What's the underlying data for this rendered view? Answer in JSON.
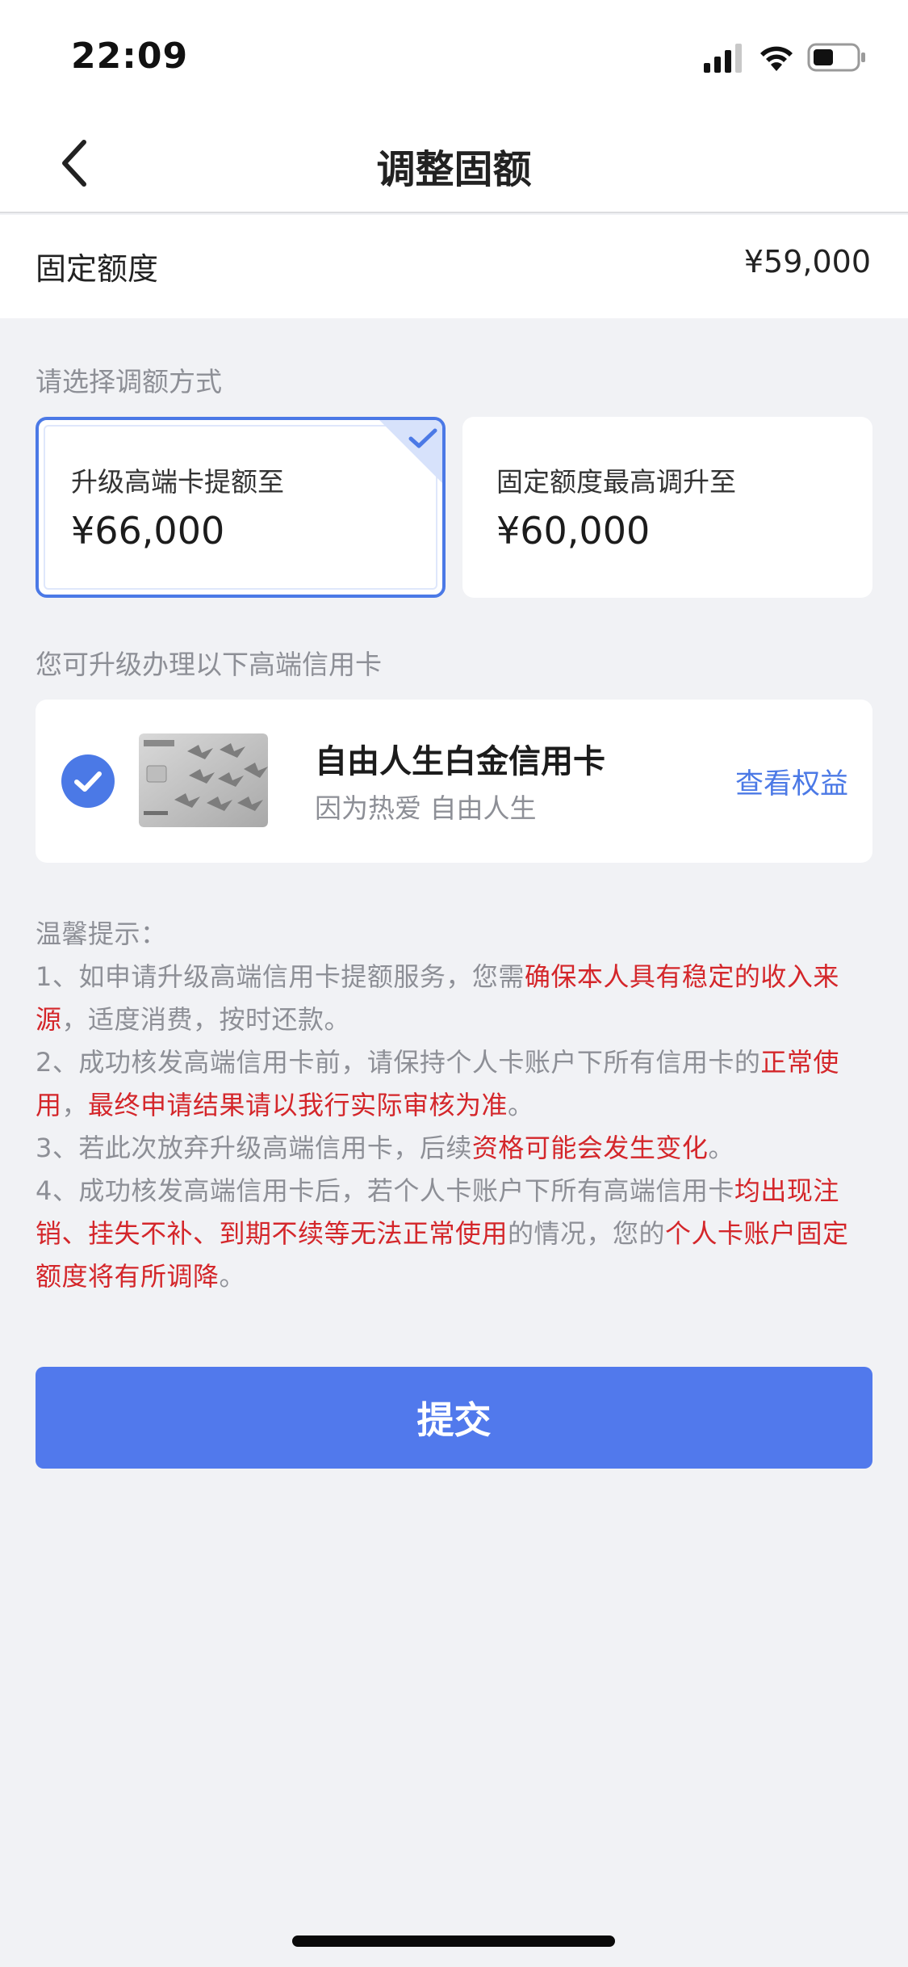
{
  "status_bar": {
    "time": "22:09"
  },
  "nav": {
    "title": "调整固额"
  },
  "fixed_amount": {
    "label": "固定额度",
    "value": "¥59,000"
  },
  "select_method_label": "请选择调额方式",
  "options": [
    {
      "title": "升级高端卡提额至",
      "amount": "¥66,000",
      "selected": true
    },
    {
      "title": "固定额度最高调升至",
      "amount": "¥60,000",
      "selected": false
    }
  ],
  "upgrade_label": "您可升级办理以下高端信用卡",
  "card": {
    "name": "自由人生白金信用卡",
    "slogan": "因为热爱 自由人生",
    "link": "查看权益"
  },
  "tips": {
    "title": "温馨提示：",
    "line1": [
      "1、如申请升级高端信用卡提额服务，您需",
      "确保本人具有稳定的收入来源",
      "，适度消费，按时还款。"
    ],
    "line2": [
      "2、成功核发高端信用卡前，请保持个人卡账户下所有信用卡的",
      "正常使用",
      "，",
      "最终申请结果请以我行实际审核为准",
      "。"
    ],
    "line3": [
      "3、若此次放弃升级高端信用卡，后续",
      "资格可能会发生变化",
      "。"
    ],
    "line4": [
      "4、成功核发高端信用卡后，若个人卡账户下所有高端信用卡",
      "均出现注销、挂失不补、到期不续等无法正常使用",
      "的情况，您的",
      "个人卡账户固定额度将有所调降",
      "。"
    ]
  },
  "submit_label": "提交",
  "colors": {
    "accent": "#4b79e6",
    "button": "#5179ec",
    "warning": "#d4262a",
    "muted": "#8d8f96",
    "background": "#f1f2f5"
  }
}
